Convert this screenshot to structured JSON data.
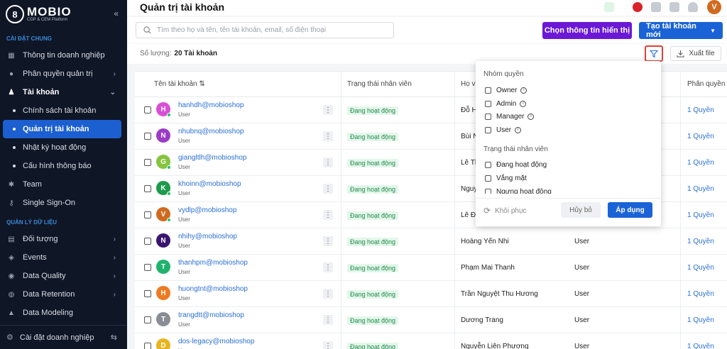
{
  "sidebar": {
    "logo_letter": "8",
    "logo_name": "MOBIO",
    "logo_sub": "CDP & CEM Platform",
    "collapse_icon": "«",
    "section1": "CÀI ĐẶT CHUNG",
    "items1": [
      {
        "label": "Thông tin doanh nghiệp",
        "icon": "building-icon"
      },
      {
        "label": "Phân quyền quản trị",
        "icon": "user-shield-icon"
      },
      {
        "label": "Tài khoản",
        "icon": "user-icon"
      }
    ],
    "sub_items": [
      "Chính sách tài khoản",
      "Quản trị tài khoản",
      "Nhật ký hoạt động",
      "Cấu hình thông báo"
    ],
    "items1b": [
      {
        "label": "Team",
        "icon": "team-icon"
      },
      {
        "label": "Single Sign-On",
        "icon": "key-icon"
      }
    ],
    "section2": "QUẢN LÝ DỮ LIỆU",
    "items2": [
      {
        "label": "Đối tượng",
        "icon": "object-icon"
      },
      {
        "label": "Events",
        "icon": "events-icon"
      },
      {
        "label": "Data Quality",
        "icon": "quality-icon"
      },
      {
        "label": "Data Retention",
        "icon": "retention-icon"
      },
      {
        "label": "Data Modeling",
        "icon": "modeling-icon"
      }
    ],
    "footer": "Cài đặt doanh nghiệp"
  },
  "header": {
    "title": "Quản trị tài khoản",
    "avatar": "V",
    "flag_color": "#d8232a"
  },
  "toolbar": {
    "search_placeholder": "Tìm theo họ và tên, tên tài khoản, email, số điện thoại",
    "choose_info_label": "Chọn thông tin hiển thị",
    "create_account_label": "Tạo tài khoản mới",
    "count_label": "Số lượng:",
    "count_value": "20 Tài khoản",
    "export_label": "Xuất file"
  },
  "table": {
    "headers": {
      "username": "Tên tài khoản",
      "status": "Trạng thái nhân viên",
      "fullname": "Họ và",
      "permission": "Phân quyền"
    },
    "rows": [
      {
        "initial": "H",
        "color": "#d84fd6",
        "online": true,
        "username": "hanhdh@mobioshop",
        "role": "User",
        "status": "Đang hoạt động",
        "fullname": "Đỗ H",
        "group": "",
        "perm": "1 Quyền"
      },
      {
        "initial": "N",
        "color": "#9b3cc8",
        "online": false,
        "username": "nhubnq@mobioshop",
        "role": "User",
        "status": "Đang hoạt động",
        "fullname": "Bùi N",
        "group": "",
        "perm": "1 Quyền"
      },
      {
        "initial": "G",
        "color": "#86c440",
        "online": true,
        "username": "giangltlh@mobioshop",
        "role": "User",
        "status": "Đang hoạt động",
        "fullname": "Lê Th",
        "group": "",
        "perm": "1 Quyền"
      },
      {
        "initial": "K",
        "color": "#1e9a4c",
        "online": true,
        "username": "khoinn@mobioshop",
        "role": "User",
        "status": "Đang hoạt động",
        "fullname": "Nguy",
        "group": "",
        "perm": "1 Quyền"
      },
      {
        "initial": "V",
        "color": "#d06a1f",
        "online": true,
        "username": "vydlp@mobioshop",
        "role": "User",
        "status": "Đang hoạt động",
        "fullname": "Lê Đ",
        "group": "",
        "perm": "1 Quyền"
      },
      {
        "initial": "N",
        "color": "#3a1570",
        "online": false,
        "username": "nhihy@mobioshop",
        "role": "User",
        "status": "Đang hoạt động",
        "fullname": "Hoàng Yến Nhi",
        "group": "User",
        "perm": "1 Quyền"
      },
      {
        "initial": "T",
        "color": "#1fb36e",
        "online": false,
        "username": "thanhpm@mobioshop",
        "role": "User",
        "status": "Đang hoạt động",
        "fullname": "Phạm Mai Thanh",
        "group": "User",
        "perm": "1 Quyền"
      },
      {
        "initial": "H",
        "color": "#ef7a22",
        "online": false,
        "username": "huongtnt@mobioshop",
        "role": "User",
        "status": "Đang hoạt động",
        "fullname": "Trần Nguyệt Thu Hương",
        "group": "User",
        "perm": "1 Quyền"
      },
      {
        "initial": "T",
        "color": "#8a8d94",
        "online": false,
        "username": "trangdtt@mobioshop",
        "role": "User",
        "status": "Đang hoạt động",
        "fullname": "Dương Trang",
        "group": "User",
        "perm": "1 Quyền"
      },
      {
        "initial": "D",
        "color": "#e8b520",
        "online": false,
        "username": "dos-legacy@mobioshop",
        "role": "User",
        "status": "Đang hoạt động",
        "fullname": "Nguyễn Liên Phương",
        "group": "User",
        "perm": "1 Quyền"
      }
    ]
  },
  "filter": {
    "group_title": "Nhóm quyền",
    "group_options": [
      "Owner",
      "Admin",
      "Manager",
      "User"
    ],
    "status_title": "Trạng thái nhân viên",
    "status_options": [
      "Đang hoạt động",
      "Vắng mặt",
      "Ngưng hoạt động"
    ],
    "restore_label": "Khôi phục",
    "cancel_label": "Hủy bỏ",
    "apply_label": "Áp dụng"
  }
}
